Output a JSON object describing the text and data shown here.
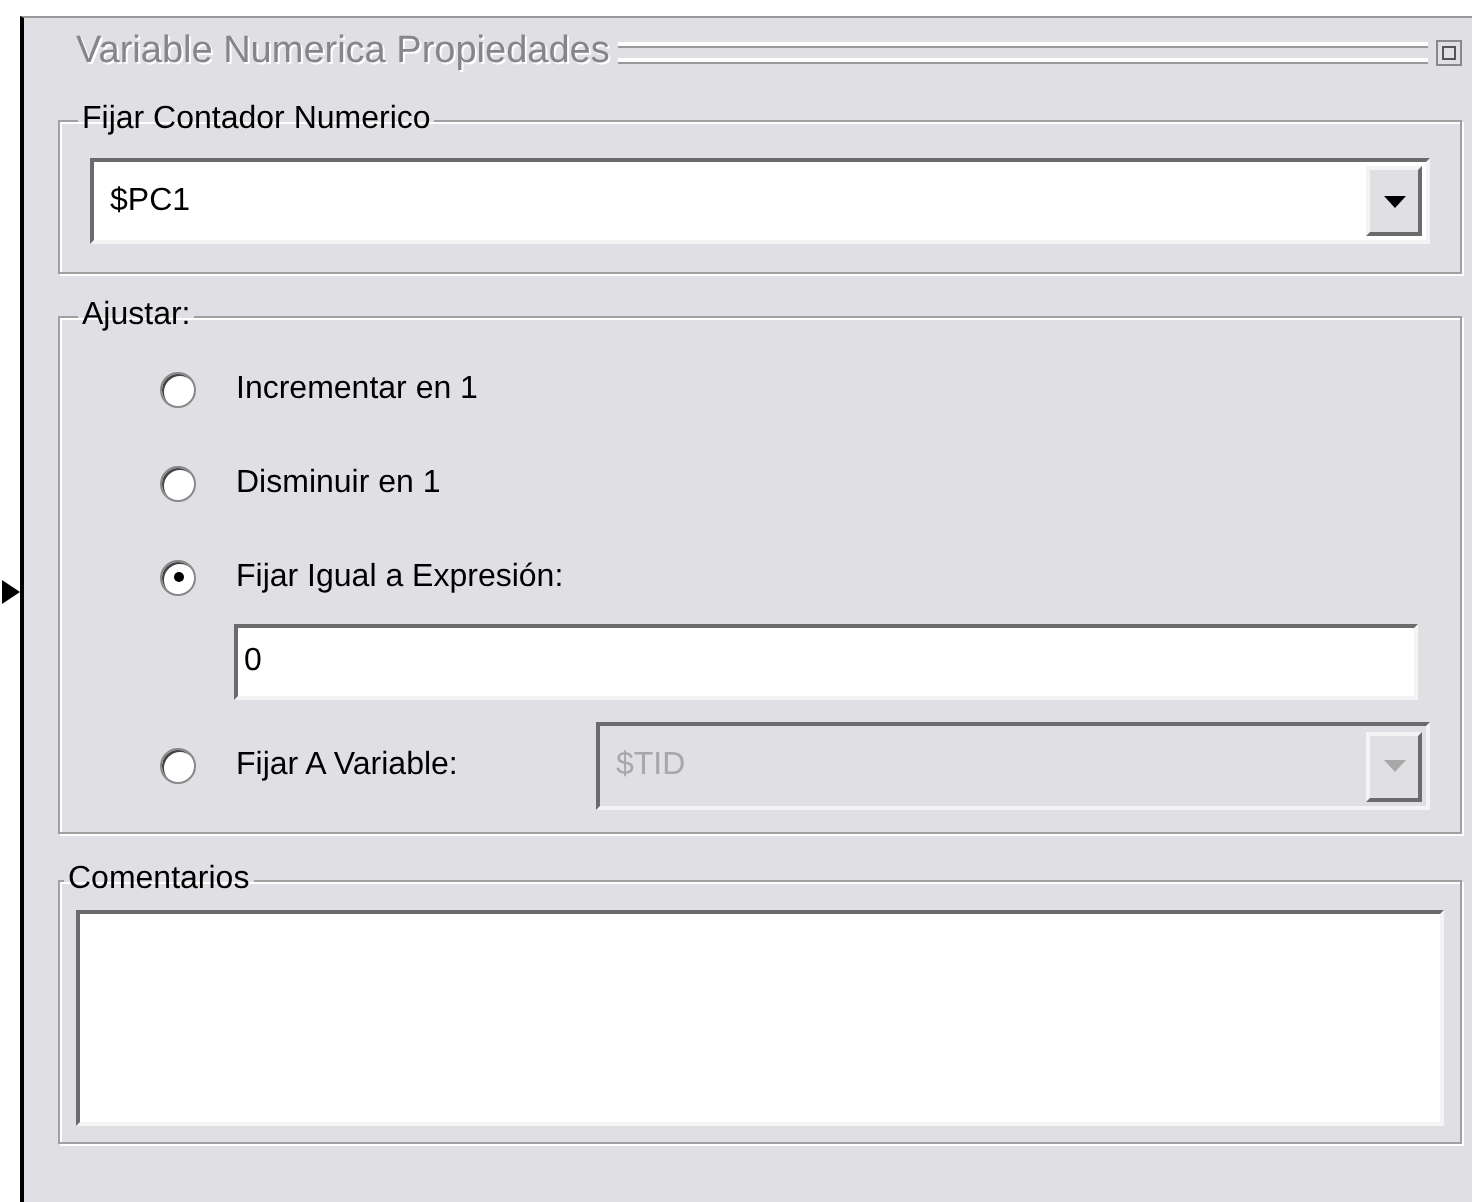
{
  "window": {
    "title": "Variable Numerica Propiedades"
  },
  "counter_group": {
    "label": "Fijar Contador Numerico",
    "value": "$PC1"
  },
  "adjust_group": {
    "label": "Ajustar:",
    "options": [
      {
        "kind": "plain",
        "label": "Incrementar en 1",
        "selected": false
      },
      {
        "kind": "plain",
        "label": "Disminuir en 1",
        "selected": false
      },
      {
        "kind": "expression",
        "label": "Fijar Igual a Expresión:",
        "selected": true,
        "value": "0"
      },
      {
        "kind": "variable",
        "label": "Fijar A Variable:",
        "selected": false,
        "value": "$TID",
        "disabled": true
      }
    ]
  },
  "comments_group": {
    "label": "Comentarios"
  }
}
